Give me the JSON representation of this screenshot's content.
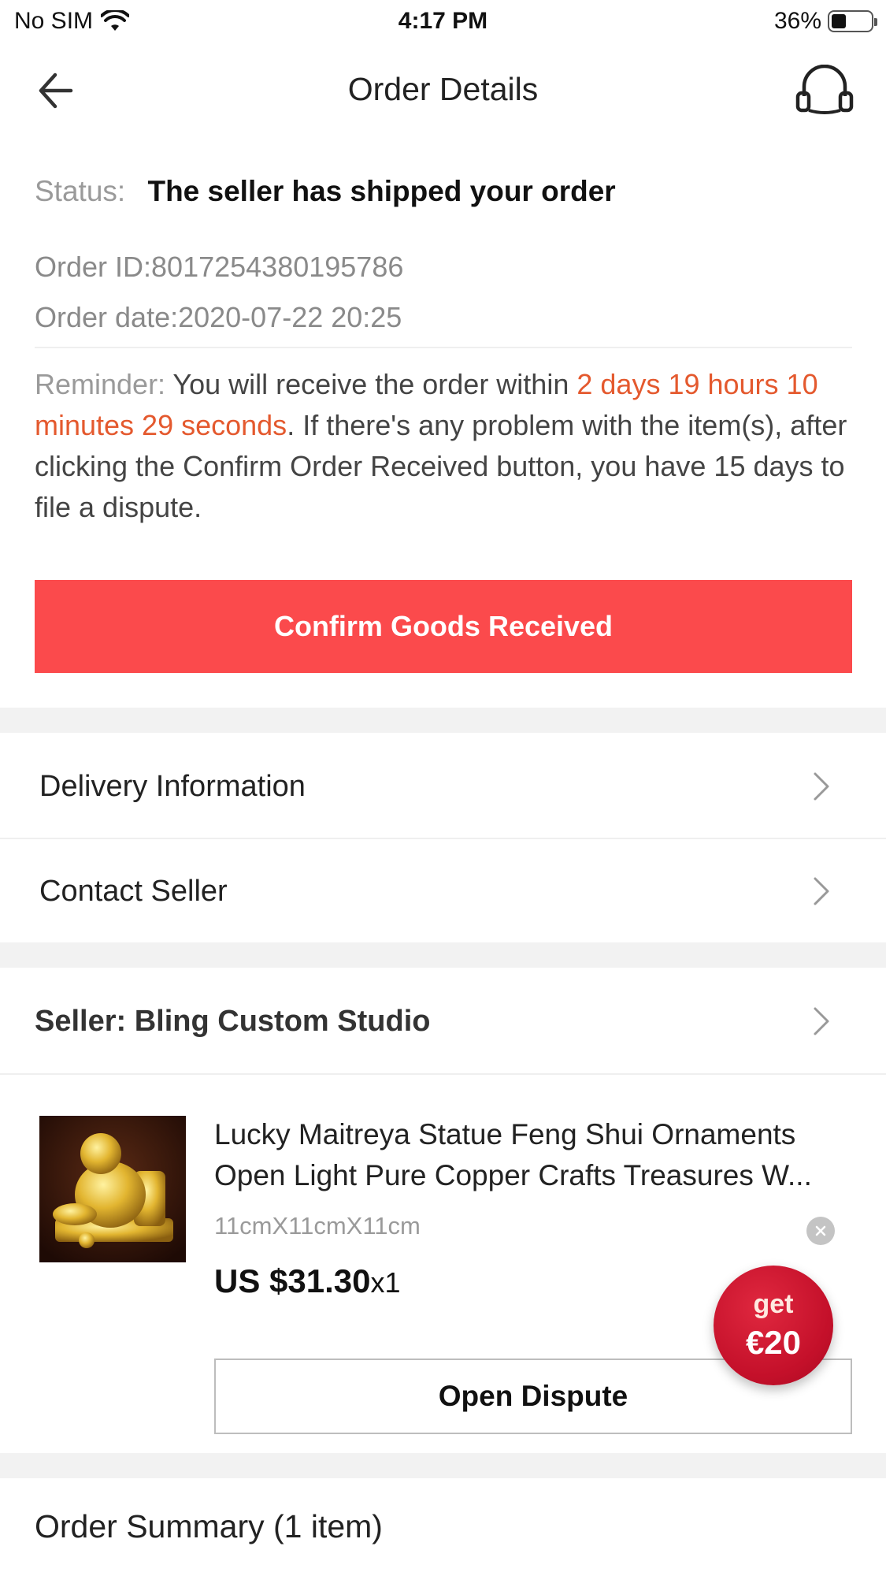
{
  "status_bar": {
    "carrier": "No SIM",
    "time": "4:17 PM",
    "battery": "36%"
  },
  "header": {
    "title": "Order Details",
    "back_icon": "back-arrow-icon",
    "support_icon": "headset-icon"
  },
  "order": {
    "status_label": "Status:",
    "status_value": "The seller has shipped your order",
    "order_id": "Order ID:8017254380195786",
    "order_date": "Order date:2020-07-22 20:25"
  },
  "reminder": {
    "label": "Reminder:",
    "text_before": "You will receive the order within",
    "time_left": "2 days 19 hours 10 minutes 29 seconds",
    "text_after": ". If there's any problem with the item(s), after clicking the Confirm Order Received button, you have 15 days to file a dispute."
  },
  "confirm_button": "Confirm Goods Received",
  "menu": [
    {
      "label": "Delivery Information"
    },
    {
      "label": "Contact Seller"
    }
  ],
  "seller": {
    "label": "Seller: Bling Custom Studio"
  },
  "product": {
    "title": "Lucky Maitreya Statue Feng Shui Ornaments Open Light Pure Copper Crafts Treasures W...",
    "sku": "11cmX11cmX11cm",
    "price": "US $31.30",
    "quantity": "x1",
    "dispute_button": "Open Dispute"
  },
  "coupon": {
    "line1": "get",
    "line2": "€20"
  },
  "summary": {
    "title": "Order Summary (1 item)"
  },
  "colors": {
    "primary_red": "#fb4a4c",
    "highlight_orange": "#e4592e",
    "coupon_red": "#c4102a"
  }
}
